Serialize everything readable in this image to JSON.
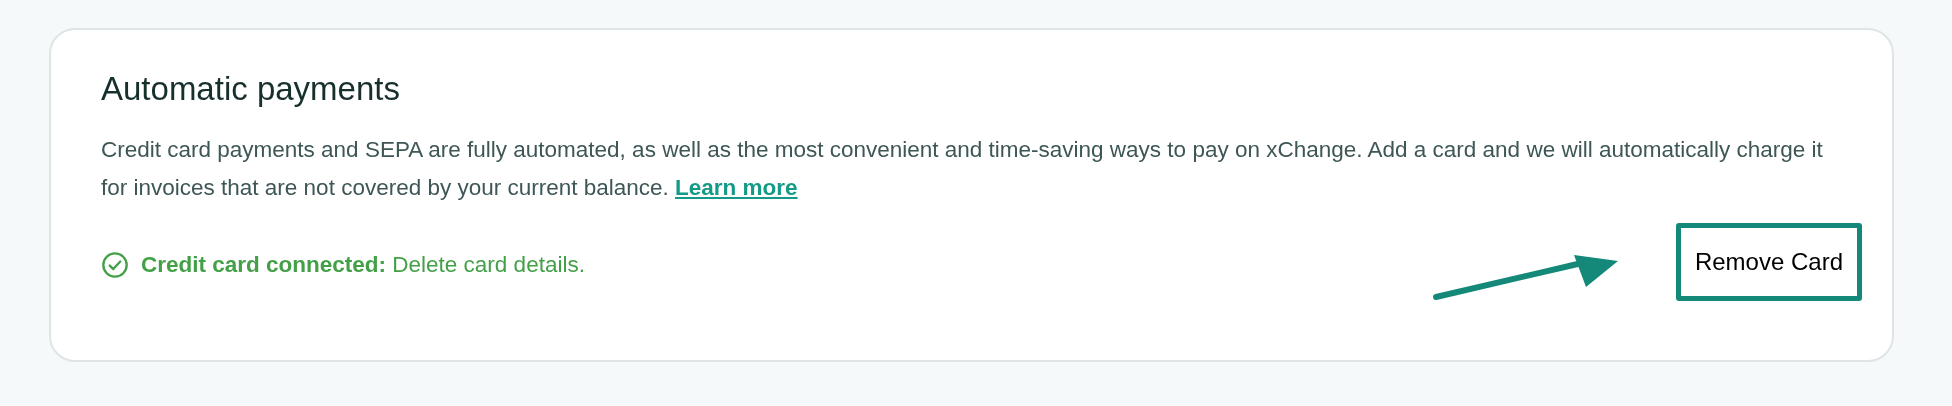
{
  "card": {
    "title": "Automatic payments",
    "description": "Credit card payments and SEPA are fully automated, as well as the most convenient and time-saving ways to pay on xChange. Add a card and we will automatically charge it for invoices that are not covered by your current balance.",
    "link": "Learn more",
    "status": {
      "kind": "success",
      "text": "**Credit card connected:** Delete card details."
    },
    "button": {
      "label": "Remove Card",
      "highlighted": true
    }
  }
}
